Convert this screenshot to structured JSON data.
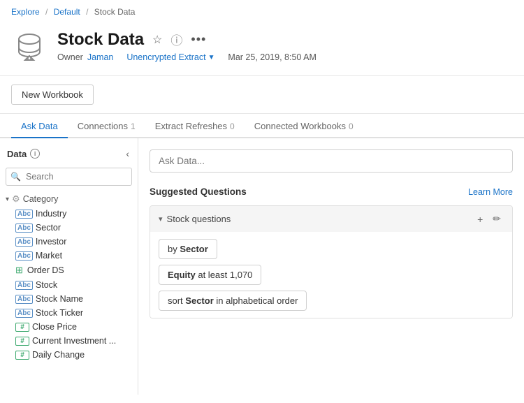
{
  "breadcrumb": {
    "explore": "Explore",
    "default": "Default",
    "current": "Stock Data"
  },
  "header": {
    "title": "Stock Data",
    "owner_label": "Owner",
    "owner_name": "Jaman",
    "extract_label": "Unencrypted Extract",
    "date": "Mar 25, 2019, 8:50 AM",
    "star_icon": "☆",
    "info_icon": "ⓘ",
    "more_icon": "•••"
  },
  "actions": {
    "new_workbook": "New Workbook"
  },
  "tabs": [
    {
      "id": "ask-data",
      "label": "Ask Data",
      "badge": "",
      "active": true
    },
    {
      "id": "connections",
      "label": "Connections",
      "badge": "1",
      "active": false
    },
    {
      "id": "extract-refreshes",
      "label": "Extract Refreshes",
      "badge": "0",
      "active": false
    },
    {
      "id": "connected-workbooks",
      "label": "Connected Workbooks",
      "badge": "0",
      "active": false
    }
  ],
  "sidebar": {
    "title": "Data",
    "search_placeholder": "Search",
    "category_label": "Category",
    "collapse_icon": "‹",
    "items": [
      {
        "type": "abc",
        "label": "Industry"
      },
      {
        "type": "abc",
        "label": "Sector"
      },
      {
        "type": "abc",
        "label": "Investor"
      },
      {
        "type": "abc",
        "label": "Market"
      },
      {
        "type": "table",
        "label": "Order DS"
      },
      {
        "type": "abc",
        "label": "Stock"
      },
      {
        "type": "abc",
        "label": "Stock Name"
      },
      {
        "type": "abc",
        "label": "Stock Ticker"
      },
      {
        "type": "hash",
        "label": "Close Price"
      },
      {
        "type": "hash",
        "label": "Current Investment ..."
      },
      {
        "type": "hash",
        "label": "Daily Change"
      }
    ]
  },
  "right_panel": {
    "ask_placeholder": "Ask Data...",
    "suggested_title": "Suggested Questions",
    "learn_more": "Learn More",
    "group_label": "Stock questions",
    "questions": [
      {
        "text": "by Sector",
        "highlight_word": "Sector",
        "highlight_start": 3
      },
      {
        "text": "Equity at least 1,070",
        "highlight_word": "Equity",
        "highlight_start": 0
      },
      {
        "text": "sort Sector in alphabetical order",
        "highlight_word": "Sector",
        "highlight_start": 5
      }
    ]
  }
}
